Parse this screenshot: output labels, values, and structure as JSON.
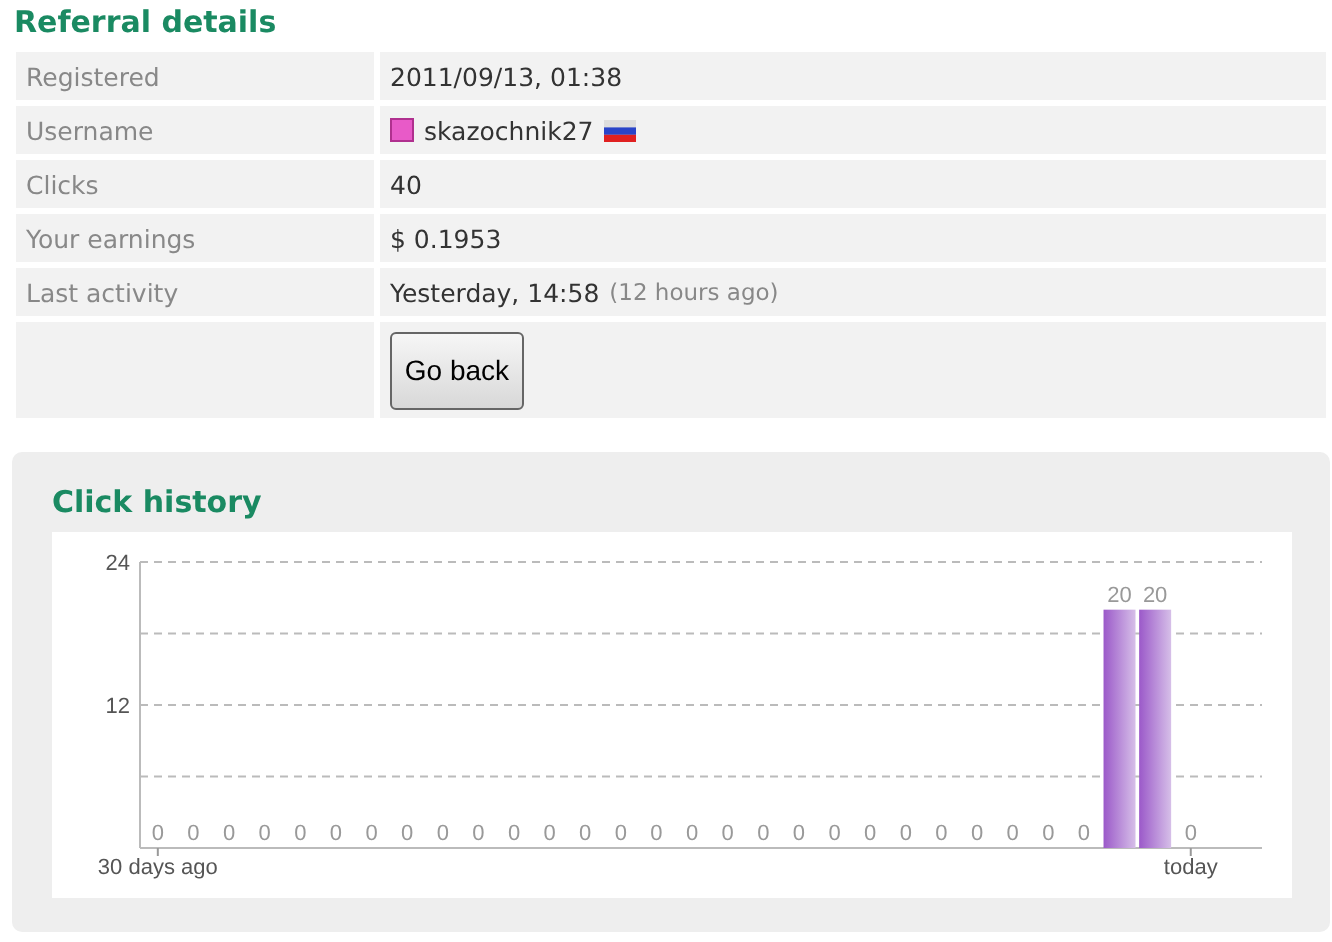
{
  "referral": {
    "title": "Referral details",
    "rows": [
      {
        "label": "Registered",
        "value": "2011/09/13, 01:38"
      },
      {
        "label": "Username",
        "value": "skazochnik27",
        "kind": "user"
      },
      {
        "label": "Clicks",
        "value": "40"
      },
      {
        "label": "Your earnings",
        "currency": "$",
        "value": "0.1953",
        "kind": "money"
      },
      {
        "label": "Last activity",
        "value": "Yesterday, 14:58",
        "note": "(12 hours ago)"
      }
    ],
    "button": "Go back"
  },
  "history": {
    "title": "Click history",
    "chart_data": {
      "type": "bar",
      "categories": [
        "30 days ago",
        null,
        null,
        null,
        null,
        null,
        null,
        null,
        null,
        null,
        null,
        null,
        null,
        null,
        null,
        null,
        null,
        null,
        null,
        null,
        null,
        null,
        null,
        null,
        null,
        null,
        null,
        null,
        null,
        "today"
      ],
      "ylim": [
        0,
        24
      ],
      "yticks": [
        12,
        24
      ],
      "data_labels": true,
      "series": [
        {
          "color": "#9b59c9",
          "values": [
            0,
            0,
            0,
            0,
            0,
            0,
            0,
            0,
            0,
            0,
            0,
            0,
            0,
            0,
            0,
            0,
            0,
            0,
            0,
            0,
            0,
            0,
            0,
            0,
            0,
            0,
            0,
            20,
            20,
            0
          ]
        }
      ]
    }
  }
}
